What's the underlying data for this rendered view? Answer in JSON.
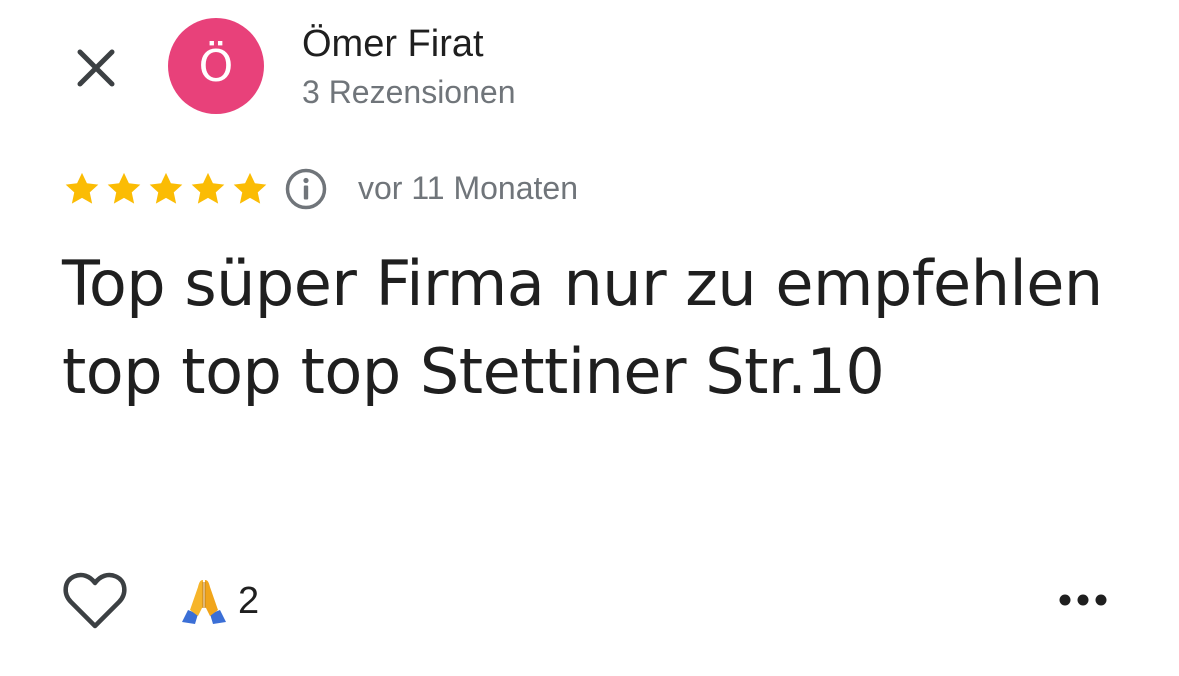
{
  "header": {
    "close_icon": "close-icon",
    "avatar_letter": "Ö",
    "avatar_color": "#e8417a",
    "author_name": "Ömer Firat",
    "review_count": "3 Rezensionen"
  },
  "rating": {
    "stars": 5,
    "max_stars": 5,
    "star_color": "#fbbc04",
    "info_icon": "info-icon",
    "date": "vor 11 Monaten"
  },
  "review": {
    "text": "Top süper Firma nur zu empfehlen top top top Stettiner Str.10"
  },
  "actions": {
    "like_icon": "heart-outline-icon",
    "reaction_icon": "folded-hands-emoji",
    "reaction_count": "2",
    "more_icon": "more-horizontal-icon"
  }
}
